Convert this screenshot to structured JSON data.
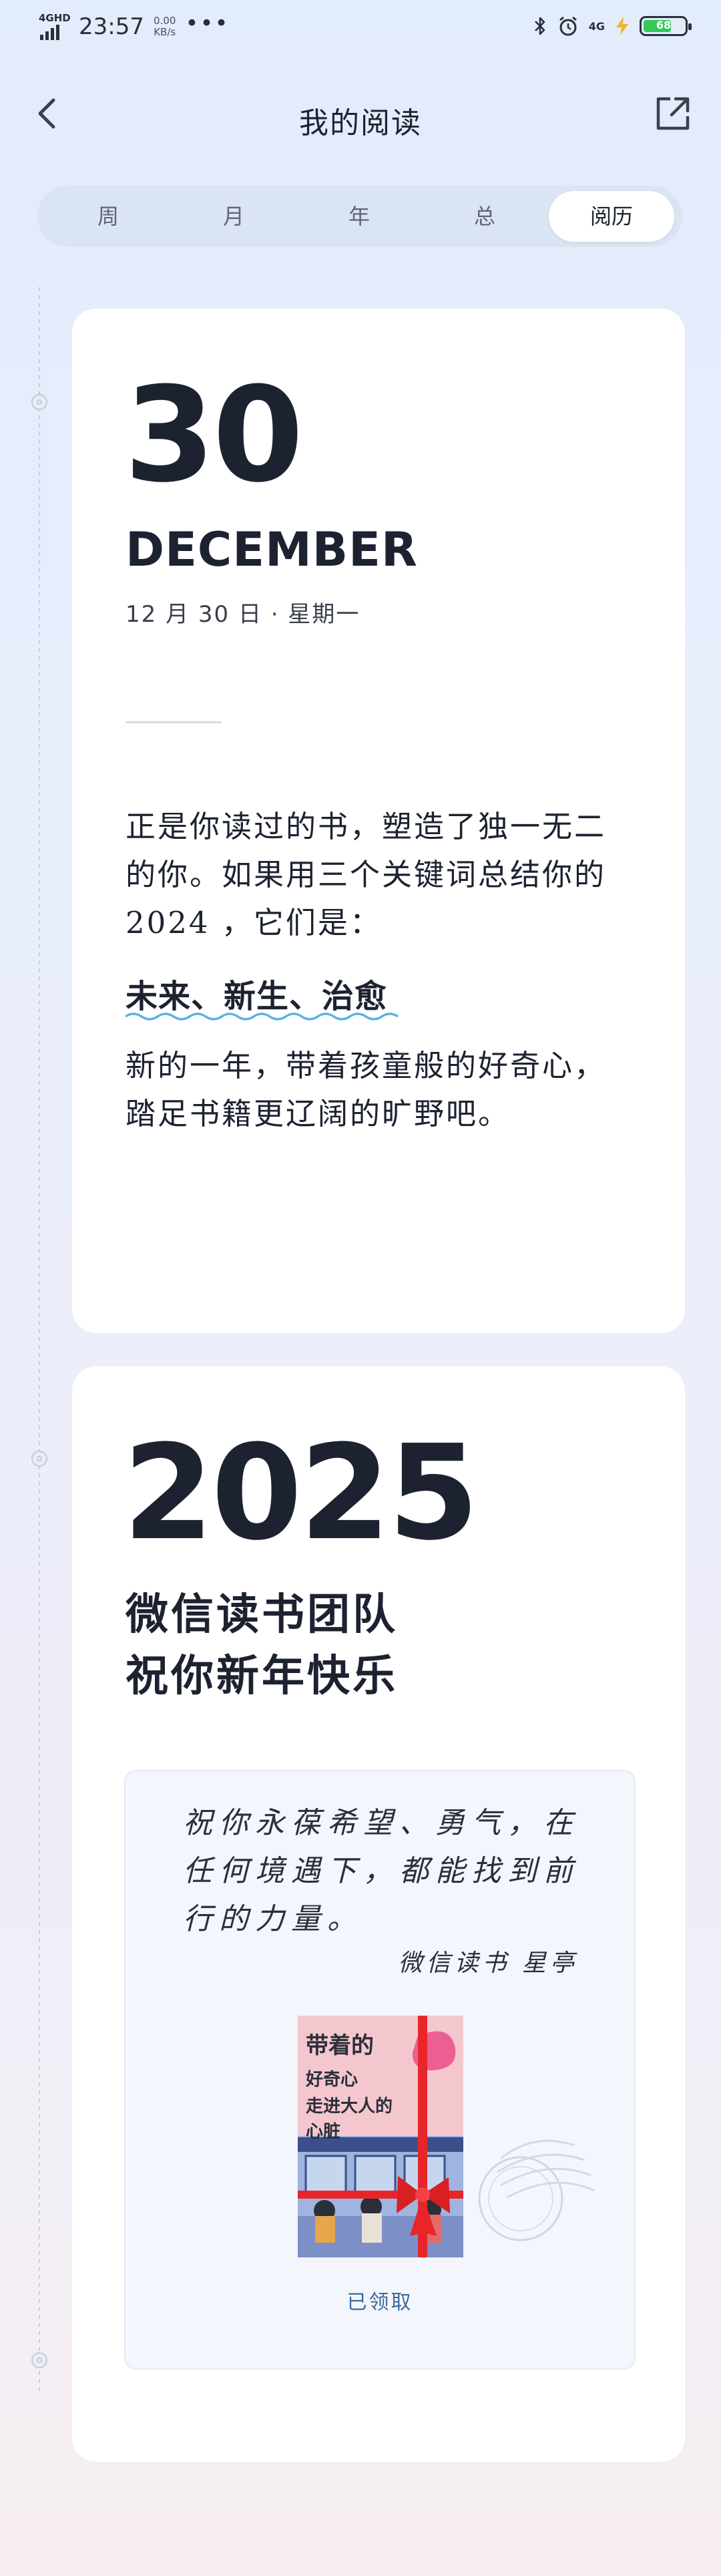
{
  "status_bar": {
    "network_badge": "4GHD",
    "time": "23:57",
    "speed_value": "0.00",
    "speed_unit": "KB/s",
    "more": "•••",
    "cell": "4G",
    "battery_level": "68",
    "battery_fraction": 0.68,
    "icons": [
      "bluetooth-icon",
      "alarm-icon",
      "charging-icon"
    ]
  },
  "header": {
    "title": "我的阅读",
    "back_icon": "chevron-left-icon",
    "share_icon": "share-icon"
  },
  "tabs": [
    {
      "label": "周",
      "active": false
    },
    {
      "label": "月",
      "active": false
    },
    {
      "label": "年",
      "active": false
    },
    {
      "label": "总",
      "active": false
    },
    {
      "label": "阅历",
      "active": true
    }
  ],
  "card1": {
    "day": "30",
    "month": "DECEMBER",
    "date_line": "12 月 30 日 · 星期一",
    "paragraph1": "正是你读过的书，塑造了独一无二的你。如果用三个关键词总结你的 2024 ，它们是：",
    "keywords": "未来、新生、治愈",
    "paragraph2": "新的一年，带着孩童般的好奇心，踏足书籍更辽阔的旷野吧。"
  },
  "card2": {
    "year": "2025",
    "team_line1": "微信读书团队",
    "team_line2": "祝你新年快乐",
    "gift": {
      "message": "祝你永葆希望、勇气，在任何境遇下，都能找到前行的力量。",
      "signature": "微信读书 星亭",
      "book_cover_text": "带着你的好奇心走进大人的心脏",
      "claimed_label": "已领取"
    }
  },
  "colors": {
    "accent_wave": "#5ab3e6",
    "ribbon": "#e8262a",
    "claimed_text": "#3c6a99",
    "tab_track": "#dbe4f3"
  }
}
